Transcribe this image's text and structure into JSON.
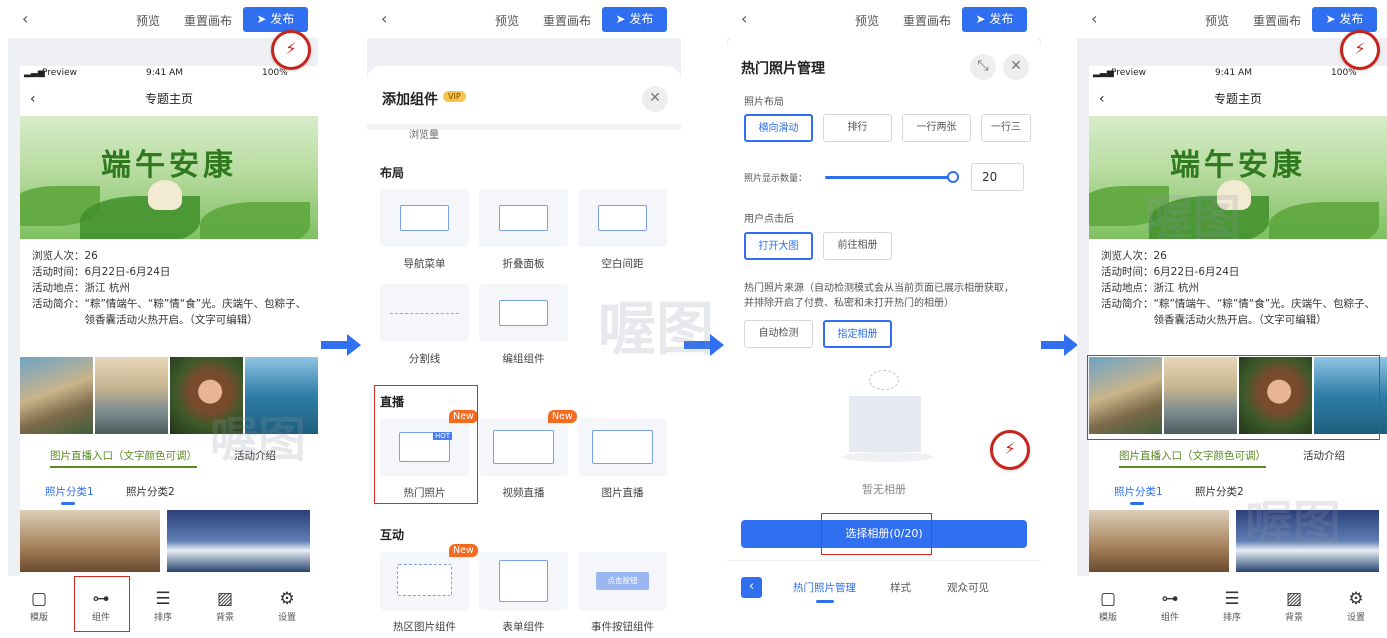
{
  "topbar": {
    "preview": "预览",
    "reset": "重置画布",
    "publish": "发布"
  },
  "phone": {
    "status_left": "Preview",
    "time": "9:41 AM",
    "battery": "100%",
    "page_title": "专题主页",
    "banner_title": "端午安康",
    "info": [
      {
        "k": "浏览人次：",
        "v": "26"
      },
      {
        "k": "活动时间：",
        "v": "6月22日-6月24日"
      },
      {
        "k": "活动地点：",
        "v": "浙江 杭州"
      },
      {
        "k": "活动简介：",
        "v": "“粽”情端午、“粽”情“食”光。庆端午、包粽子、领香囊活动火热开启。（文字可编辑）"
      }
    ],
    "tab_live": "图片直播入口（文字颜色可调）",
    "tab_intro": "活动介绍",
    "cat1": "照片分类1",
    "cat2": "照片分类2"
  },
  "bottom_nav": [
    {
      "label": "模版",
      "icon": "template-icon"
    },
    {
      "label": "组件",
      "icon": "components-icon"
    },
    {
      "label": "排序",
      "icon": "sort-icon"
    },
    {
      "label": "背景",
      "icon": "background-icon"
    },
    {
      "label": "设置",
      "icon": "settings-icon"
    }
  ],
  "add_panel": {
    "title": "添加组件",
    "vip": "VIP",
    "browse": "浏览量",
    "sec_layout": "布局",
    "layout_items": [
      "导航菜单",
      "折叠面板",
      "空白间距",
      "分割线",
      "编组组件"
    ],
    "sec_live": "直播",
    "live_items": [
      "热门照片",
      "视频直播",
      "图片直播"
    ],
    "sec_interact": "互动",
    "interact_items": [
      "热区图片组件",
      "表单组件",
      "事件按钮组件"
    ],
    "new_tag": "New",
    "hot_tag": "HOT",
    "event_btn": "点击按钮"
  },
  "hot_panel": {
    "title": "热门照片管理",
    "layout_label": "照片布局",
    "layout_options": [
      "横向滑动",
      "排行",
      "一行两张",
      "一行三"
    ],
    "count_label": "照片显示数量：",
    "count_value": "20",
    "count_fraction": 1.0,
    "click_label": "用户点击后",
    "click_options": [
      "打开大图",
      "前往相册"
    ],
    "source_label": "热门照片来源（自动检测模式会从当前页面已展示相册获取，并排除开启了付费、私密和未打开热门的相册）",
    "source_options": [
      "自动检测",
      "指定相册"
    ],
    "empty_text": "暂无相册",
    "select_button": "选择相册(0/20)",
    "tabs": [
      "热门照片管理",
      "样式",
      "观众可见"
    ]
  },
  "watermark": "喔图",
  "colors": {
    "accent": "#2f6ff0",
    "highlight": "#d8281f",
    "new_tag": "#f46a1f",
    "live_tab": "#5a8a1f"
  }
}
